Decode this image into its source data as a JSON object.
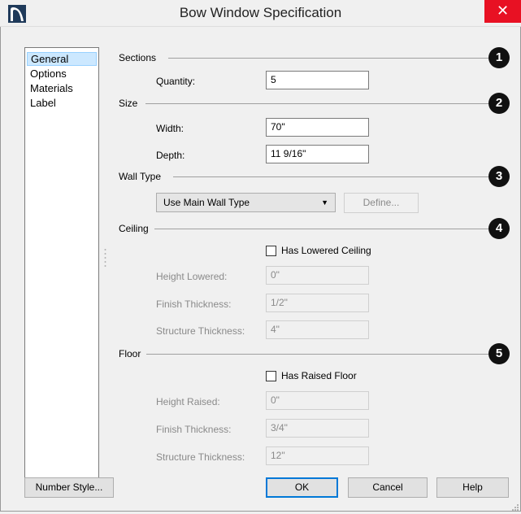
{
  "window": {
    "title": "Bow Window Specification",
    "close": "✕"
  },
  "nav": {
    "items": [
      "General",
      "Options",
      "Materials",
      "Label"
    ],
    "selected": 0
  },
  "sections": {
    "sections": {
      "label": "Sections",
      "badge": "1",
      "quantity_label": "Quantity:",
      "quantity_value": "5"
    },
    "size": {
      "label": "Size",
      "badge": "2",
      "width_label": "Width:",
      "width_value": "70\"",
      "depth_label": "Depth:",
      "depth_value": "11 9/16\""
    },
    "wall_type": {
      "label": "Wall Type",
      "badge": "3",
      "selected": "Use Main Wall Type",
      "define_label": "Define..."
    },
    "ceiling": {
      "label": "Ceiling",
      "badge": "4",
      "checkbox_label": "Has Lowered Ceiling",
      "checked": false,
      "height_label": "Height Lowered:",
      "height_value": "0\"",
      "finish_label": "Finish Thickness:",
      "finish_value": "1/2\"",
      "structure_label": "Structure Thickness:",
      "structure_value": "4\""
    },
    "floor": {
      "label": "Floor",
      "badge": "5",
      "checkbox_label": "Has Raised Floor",
      "checked": false,
      "height_label": "Height Raised:",
      "height_value": "0\"",
      "finish_label": "Finish Thickness:",
      "finish_value": "3/4\"",
      "structure_label": "Structure Thickness:",
      "structure_value": "12\""
    }
  },
  "buttons": {
    "number_style": "Number Style...",
    "ok": "OK",
    "cancel": "Cancel",
    "help": "Help"
  },
  "colors": {
    "close_bg": "#e81123",
    "selection": "#cce8ff",
    "default_border": "#0078d7"
  }
}
